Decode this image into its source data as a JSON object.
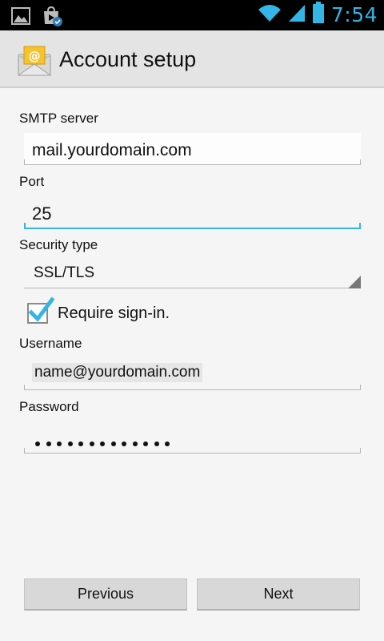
{
  "status_bar": {
    "clock": "7:54",
    "icons": [
      "gallery-icon",
      "play-store-update-icon",
      "wifi-icon",
      "signal-icon",
      "battery-icon"
    ],
    "clock_color": "#33b5e5"
  },
  "header": {
    "title": "Account setup",
    "icon": "email-app-icon"
  },
  "form": {
    "smtp_label": "SMTP server",
    "smtp_value": "mail.yourdomain.com",
    "port_label": "Port",
    "port_value": "25",
    "security_label": "Security type",
    "security_value": "SSL/TLS",
    "require_signin_label": "Require sign-in.",
    "require_signin_checked": true,
    "username_label": "Username",
    "username_value": "name@yourdomain.com",
    "password_label": "Password",
    "password_mask": "•••••••••••••"
  },
  "buttons": {
    "previous": "Previous",
    "next": "Next"
  },
  "colors": {
    "accent": "#33b5e5"
  }
}
